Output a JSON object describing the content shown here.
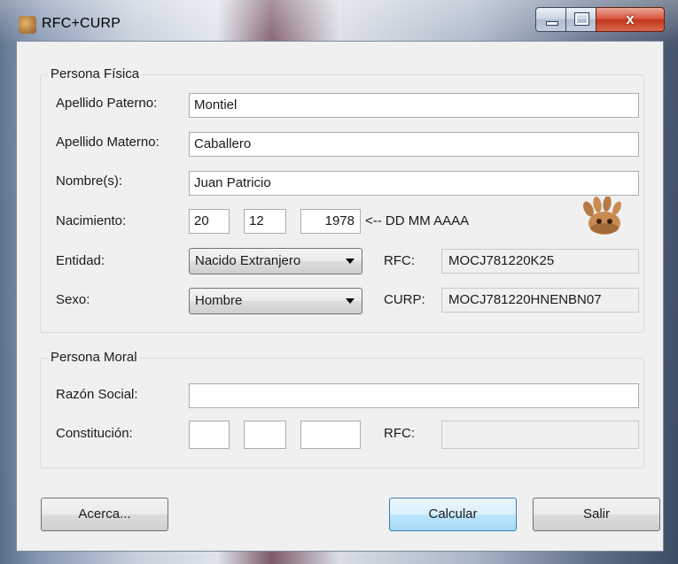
{
  "window": {
    "title": "RFC+CURP",
    "minimize_glyph": "",
    "close_glyph": "x"
  },
  "persona_fisica": {
    "legend": "Persona Física",
    "apellido_paterno": {
      "label": "Apellido Paterno:",
      "value": "Montiel"
    },
    "apellido_materno": {
      "label": "Apellido Materno:",
      "value": "Caballero"
    },
    "nombres": {
      "label": "Nombre(s):",
      "value": "Juan Patricio"
    },
    "nacimiento": {
      "label": "Nacimiento:",
      "dd": "20",
      "mm": "12",
      "aaaa": "1978",
      "hint": "<-- DD  MM  AAAA"
    },
    "entidad": {
      "label": "Entidad:",
      "value": "Nacido Extranjero"
    },
    "sexo": {
      "label": "Sexo:",
      "value": "Hombre"
    },
    "rfc": {
      "label": "RFC:",
      "value": "MOCJ781220K25"
    },
    "curp": {
      "label": "CURP:",
      "value": "MOCJ781220HNENBN07"
    }
  },
  "persona_moral": {
    "legend": "Persona Moral",
    "razon_social": {
      "label": "Razón Social:",
      "value": ""
    },
    "constitucion": {
      "label": "Constitución:",
      "dd": "",
      "mm": "",
      "aaaa": ""
    },
    "rfc": {
      "label": "RFC:",
      "value": ""
    }
  },
  "buttons": {
    "acerca": "Acerca...",
    "calcular": "Calcular",
    "salir": "Salir"
  },
  "icons": {
    "app": "hand-app-icon",
    "decor": "hand-icon"
  }
}
